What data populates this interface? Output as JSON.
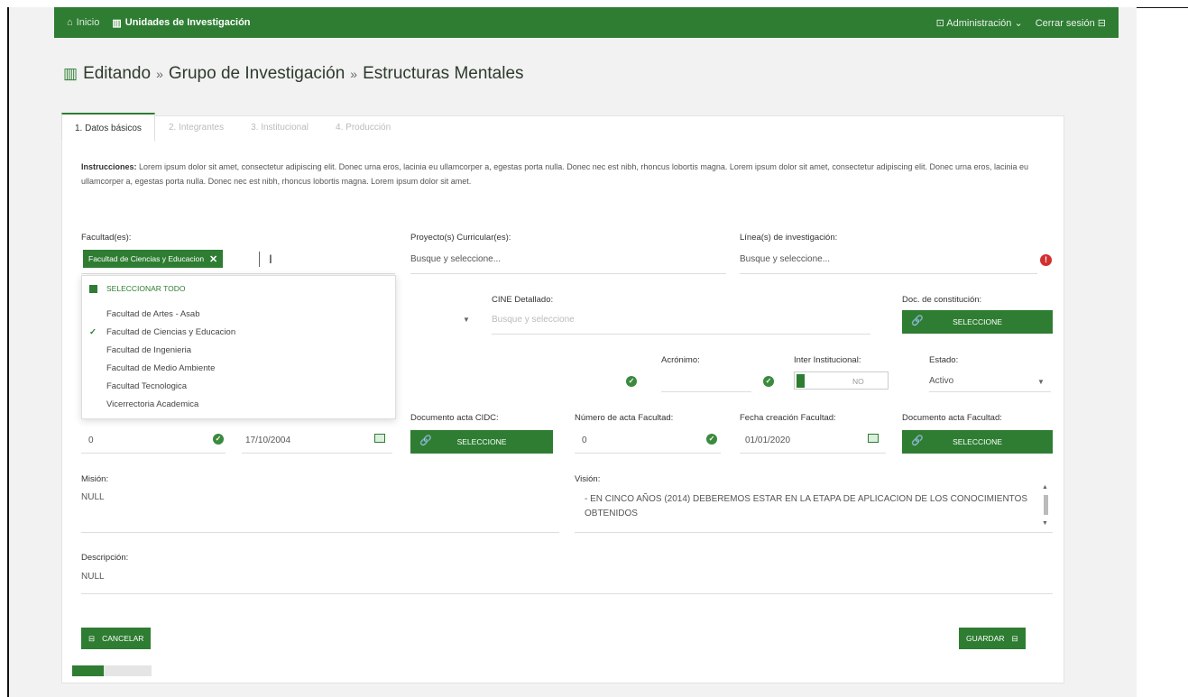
{
  "topbar": {
    "home_label": "Inicio",
    "units_label": "Unidades de Investigación",
    "admin_label": "Administración",
    "logout_label": "Cerrar sesión"
  },
  "title": {
    "part1": "Editando",
    "sep1": "»",
    "part2": "Grupo de Investigación",
    "sep2": "»",
    "part3": "Estructuras Mentales"
  },
  "tabs": [
    {
      "label": "1. Datos básicos",
      "active": true
    },
    {
      "label": "2. Integrantes",
      "active": false
    },
    {
      "label": "3. Institucional",
      "active": false
    },
    {
      "label": "4. Producción",
      "active": false
    }
  ],
  "instructions": {
    "lead": "Instrucciones:",
    "text": "Lorem ipsum dolor sit amet, consectetur adipiscing elit. Donec urna eros, lacinia eu ullamcorper a, egestas porta nulla. Donec nec est nibh, rhoncus lobortis magna. Lorem ipsum dolor sit amet, consectetur adipiscing elit. Donec urna eros, lacinia eu ullamcorper a, egestas porta nulla. Donec nec est nibh, rhoncus lobortis magna. Lorem ipsum dolor sit amet."
  },
  "facultades": {
    "label": "Facultad(es):",
    "chip": "Facultad de Ciencias y Educacion",
    "select_all": "SELECCIONAR TODO",
    "options": [
      {
        "label": "Facultad de Artes - Asab",
        "selected": false
      },
      {
        "label": "Facultad de Ciencias y Educacion",
        "selected": true
      },
      {
        "label": "Facultad de Ingenieria",
        "selected": false
      },
      {
        "label": "Facultad de Medio Ambiente",
        "selected": false
      },
      {
        "label": "Facultad Tecnologica",
        "selected": false
      },
      {
        "label": "Vicerrectoria Academica",
        "selected": false
      }
    ]
  },
  "proyectos": {
    "label": "Proyecto(s) Curricular(es):",
    "placeholder": "Busque y seleccione..."
  },
  "lineas": {
    "label": "Línea(s) de investigación:",
    "placeholder": "Busque y seleccione..."
  },
  "cine": {
    "label": "CINE Detallado:",
    "placeholder": "Busque y seleccione"
  },
  "doc_constitucion": {
    "label": "Doc. de constitución:",
    "button": "SELECCIONE"
  },
  "acronimo": {
    "label": "Acrónimo:"
  },
  "inter": {
    "label": "Inter Institucional:",
    "value": "NO"
  },
  "estado": {
    "label": "Estado:",
    "value": "Activo"
  },
  "numero_cidc": {
    "value": "0"
  },
  "fecha_cidc": {
    "value": "17/10/2004"
  },
  "documento_cidc": {
    "label": "Documento acta CIDC:",
    "button": "SELECCIONE"
  },
  "numero_facultad": {
    "label": "Número de acta Facultad:",
    "value": "0"
  },
  "fecha_facultad": {
    "label": "Fecha creación Facultad:",
    "value": "01/01/2020"
  },
  "documento_facultad": {
    "label": "Documento acta Facultad:",
    "button": "SELECCIONE"
  },
  "mision": {
    "label": "Misión:",
    "value": "NULL"
  },
  "vision": {
    "label": "Visión:",
    "value": "- EN CINCO AÑOS (2014) DEBEREMOS ESTAR EN LA ETAPA DE APLICACION DE LOS CONOCIMIENTOS OBTENIDOS"
  },
  "descripcion": {
    "label": "Descripción:",
    "value": "NULL"
  },
  "buttons": {
    "cancel": "CANCELAR",
    "save": "GUARDAR"
  },
  "progress": {
    "fraction": 0.4
  },
  "colors": {
    "primary": "#2e7d32",
    "error": "#d32f2f"
  }
}
